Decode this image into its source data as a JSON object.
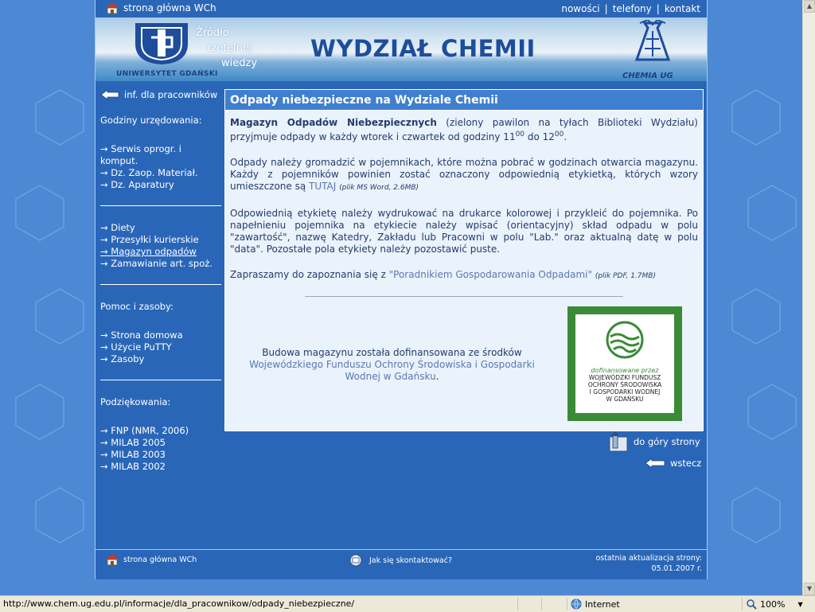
{
  "topbar": {
    "home_label": "strona główna WCh",
    "links": [
      "nowości",
      "telefony",
      "kontakt"
    ]
  },
  "banner": {
    "university": "UNIWERSYTET GDAŃSKI",
    "motto_lines": [
      "Źródło",
      "rzetelnej",
      "wiedzy"
    ],
    "title": "WYDZIAŁ CHEMII",
    "chem_logo_text": "CHEMIA UG"
  },
  "leftnav": {
    "back_label": "inf. dla pracowników",
    "section1_title": "Godziny urzędowania:",
    "section1_items": [
      "→ Serwis oprogr. i komput.",
      "→ Dz. Zaop. Materiał.",
      "→ Dz. Aparatury"
    ],
    "section2_items": [
      "→ Diety",
      "→ Przesyłki kurierskie",
      "→ Magazyn odpadów",
      "→ Zamawianie art. spoż."
    ],
    "section2_active_index": 2,
    "section3_title": "Pomoc i zasoby:",
    "section3_items": [
      "→ Strona domowa",
      "→ Użycie PuTTY",
      "→ Zasoby"
    ],
    "section4_title": "Podziękowania:",
    "section4_items": [
      "→ FNP (NMR, 2006)",
      "→ MILAB 2005",
      "→ MILAB 2003",
      "→ MILAB 2002"
    ]
  },
  "content": {
    "heading": "Odpady niebezpieczne na Wydziale Chemii",
    "p1_strong": "Magazyn Odpadów Niebezpiecznych",
    "p1_text_a": " (zielony pawilon na tyłach Biblioteki Wydziału) przyjmuje odpady w każdy wtorek i czwartek od godziny 11",
    "p1_sup1": "00",
    "p1_text_b": " do 12",
    "p1_sup2": "00",
    "p1_text_c": ".",
    "p2_text": "Odpady należy gromadzić w pojemnikach, które można pobrać w godzinach otwarcia magazynu. Każdy z pojemników powinien zostać oznaczony odpowiednią etykietką, których wzory umieszczone są ",
    "p2_link": "TUTAJ",
    "p2_small": "(plik MS Word, 2.6MB)",
    "p3_text": "Odpowiednią etykietę należy wydrukować na drukarce kolorowej i przykleić do pojemnika. Po napełnieniu pojemnika na etykiecie należy wpisać (orientacyjny) skład odpadu w polu \"zawartość\", nazwę Katedry, Zakładu lub Pracowni w polu \"Lab.\" oraz aktualną datę w polu \"data\". Pozostałe pola etykiety należy pozostawić puste.",
    "p4_text": "Zapraszamy do zapoznania się z ",
    "p4_link": "\"Poradnikiem Gospodarowania Odpadami\"",
    "p4_small": "(plik PDF, 1.7MB)",
    "fund_text": "Budowa magazynu została dofinansowana ze środków ",
    "fund_link": "Wojewódzkiego Funduszu Ochrony Środowiska i Gospodarki Wodnej w Gdańsku",
    "fund_end": ".",
    "fund_logo_green": "dofinansowane przez",
    "fund_logo_lines": [
      "WOJEWÓDZKI FUNDUSZ",
      "OCHRONY ŚRODOWISKA",
      "I GOSPODARKI WODNEJ",
      "W GDAŃSKU"
    ]
  },
  "nav_links": {
    "up": "do góry strony",
    "back": "wstecz"
  },
  "footer": {
    "home": "strona główna WCh",
    "contact": "Jak się skontaktować?",
    "update_label": "ostatnia aktualizacja strony:",
    "update_date": "05.01.2007 r."
  },
  "statusbar": {
    "url": "http://www.chem.ug.edu.pl/informacje/dla_pracownikow/odpady_niebezpieczne/",
    "zone": "Internet",
    "zoom": "100%"
  },
  "colors": {
    "page_bg": "#4c88d3",
    "container": "#2a66b8",
    "content_bg": "#eaf2fb",
    "heading_bg": "#3f7fcf",
    "fund_green": "#3a8a36"
  }
}
